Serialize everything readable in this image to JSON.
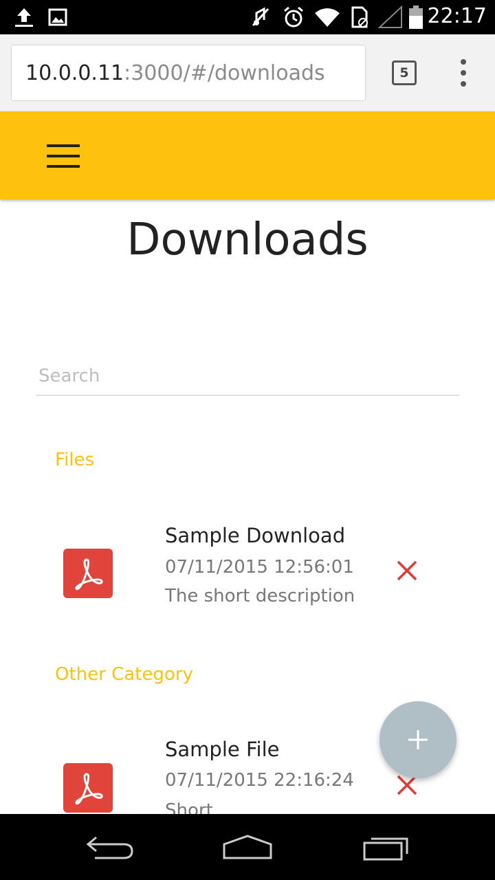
{
  "status_bar": {
    "time": "22:17",
    "icons": [
      "upload-icon",
      "image-icon",
      "mute-icon",
      "alarm-icon",
      "wifi-icon",
      "sim-icon",
      "signal-icon",
      "battery-icon"
    ]
  },
  "browser": {
    "url_host": "10.0.0.11",
    "url_path": ":3000/#/downloads",
    "tab_count": "5",
    "menu_icon": "more-vert-icon"
  },
  "app_bar": {
    "menu_icon": "hamburger-menu-icon",
    "color": "#fec10d"
  },
  "page": {
    "title": "Downloads"
  },
  "search": {
    "placeholder": "Search",
    "value": ""
  },
  "categories": [
    {
      "name": "Files",
      "items": [
        {
          "title": "Sample Download",
          "date": "07/11/2015 12:56:01",
          "description": "The short description",
          "icon": "pdf-icon"
        }
      ]
    },
    {
      "name": "Other Category",
      "items": [
        {
          "title": "Sample File",
          "date": "07/11/2015 22:16:24",
          "description": "Short",
          "icon": "pdf-icon"
        }
      ]
    }
  ],
  "fab": {
    "icon": "plus-icon",
    "color": "#b0bec5"
  },
  "colors": {
    "accent": "#fec10d",
    "delete": "#e53935",
    "pdf": "#e0443a"
  },
  "nav_bar": {
    "icons": [
      "back-icon",
      "home-icon",
      "recents-icon"
    ]
  }
}
